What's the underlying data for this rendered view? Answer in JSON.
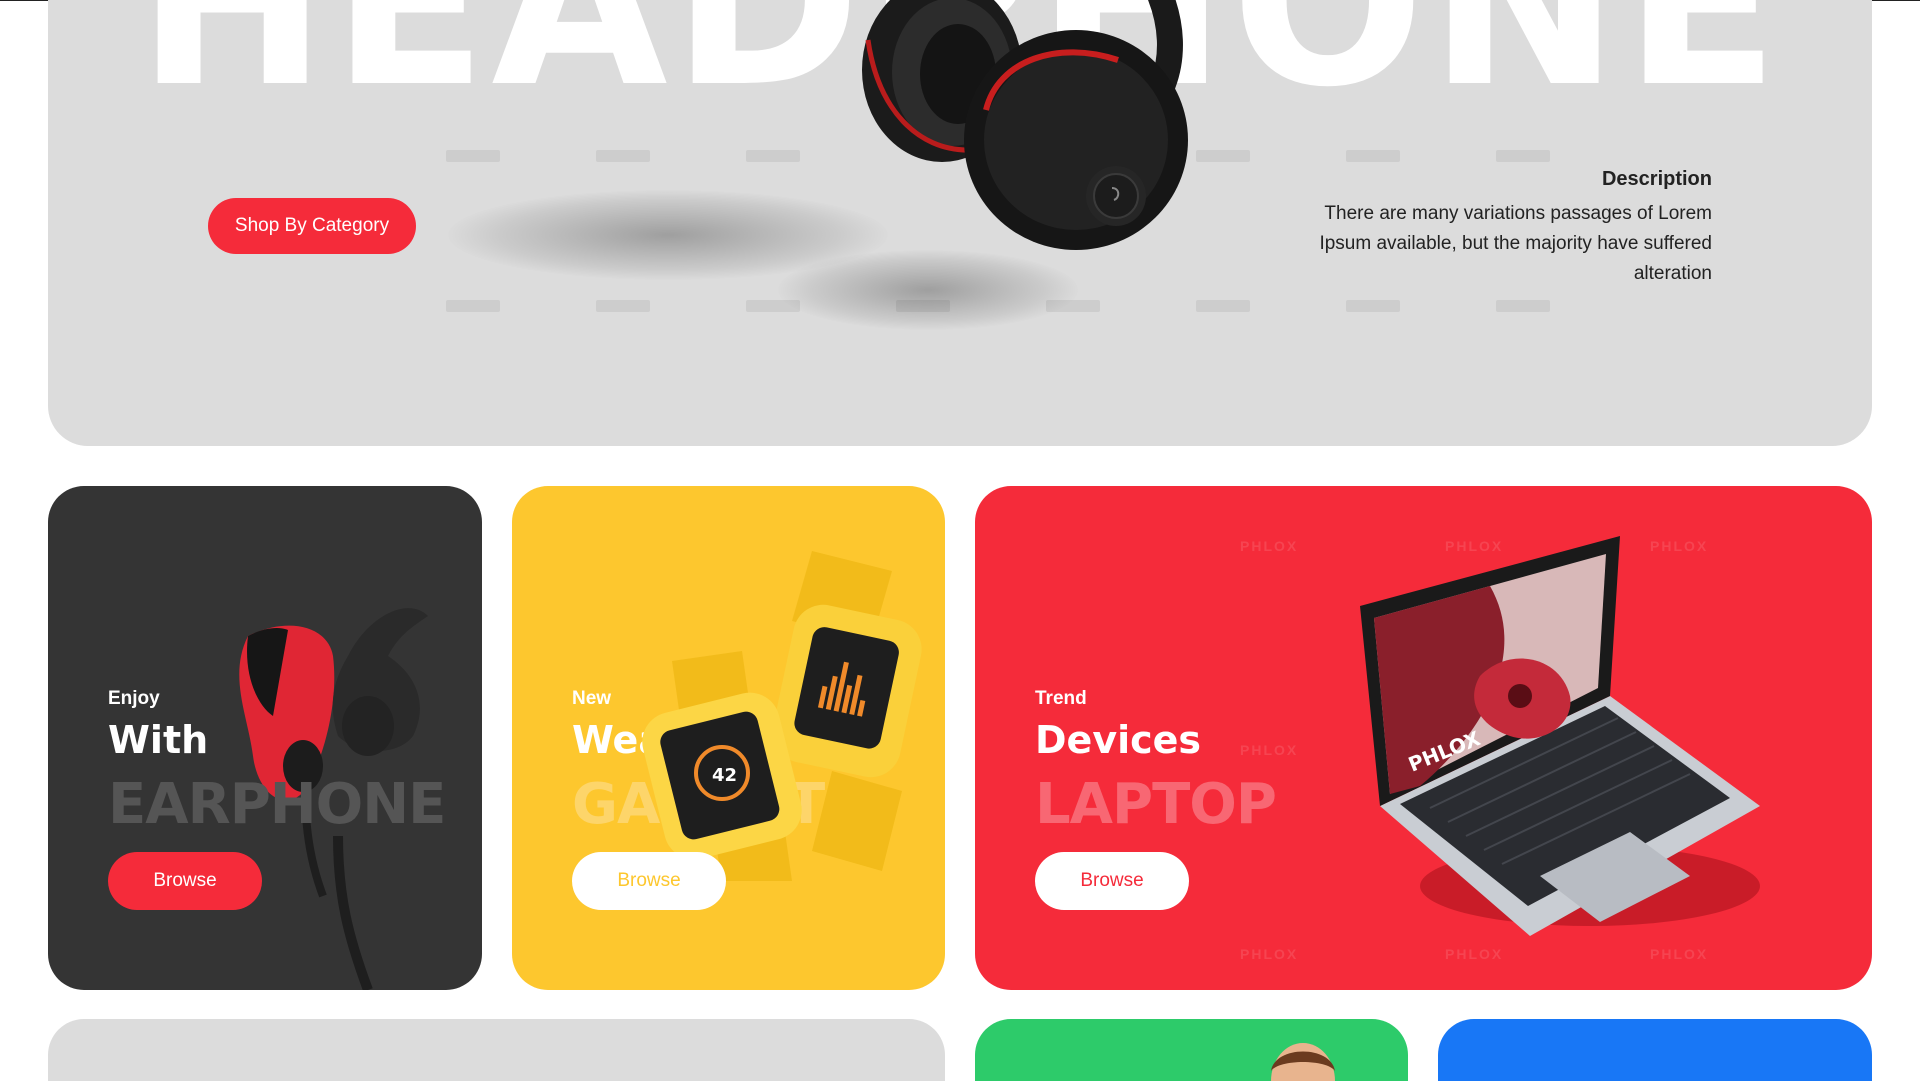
{
  "hero": {
    "title": "HEADPHONE",
    "shop_button": "Shop By Category",
    "description_title": "Description",
    "description_text": "There are many variations passages of Lorem Ipsum available, but the majority have suffered alteration",
    "colors": {
      "background": "#dcdcdc",
      "accent": "#f52b3a"
    },
    "image_icon": "headphone-image"
  },
  "cards": [
    {
      "kicker": "Enjoy",
      "heading": "With",
      "big": "EARPHONE",
      "button": "Browse",
      "color": "#343434",
      "image_icon": "earphone-image"
    },
    {
      "kicker": "New",
      "heading": "Wearable",
      "big": "GADGET",
      "button": "Browse",
      "color": "#fdc72e",
      "image_icon": "smartwatch-image",
      "watch_readout": "42"
    },
    {
      "kicker": "Trend",
      "heading": "Devices",
      "big": "LAPTOP",
      "button": "Browse",
      "color": "#f52b3a",
      "image_icon": "laptop-image",
      "screen_label": "PHLOX",
      "watermark": "PHLOX"
    }
  ],
  "bottom_row": [
    {
      "name": "gray",
      "color": "#dcdcdc"
    },
    {
      "name": "green",
      "color": "#2dcb6a"
    },
    {
      "name": "blue",
      "color": "#1877f6"
    }
  ]
}
